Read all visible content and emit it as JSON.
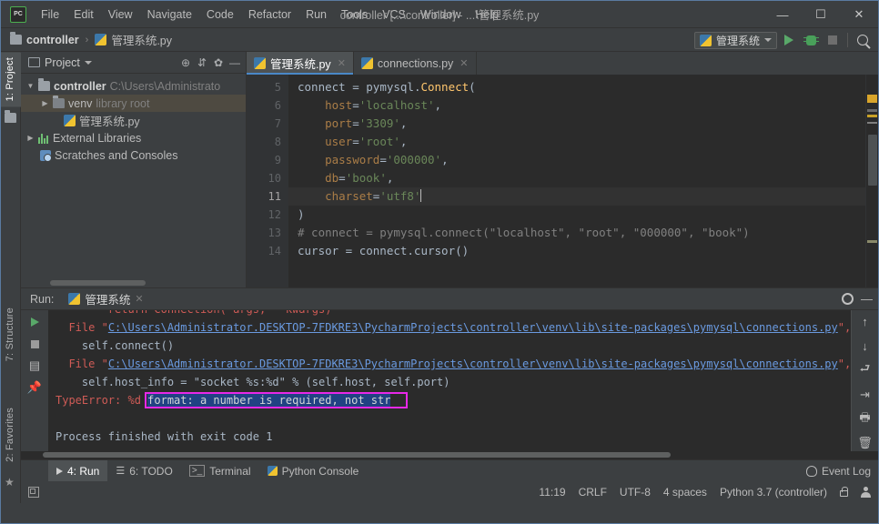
{
  "window": {
    "title": "controller [...\\controller] - ...\\管理系统.py",
    "logo_text": "PC",
    "minimize": "—",
    "maximize": "☐",
    "close": "✕"
  },
  "menu": {
    "items": [
      "File",
      "Edit",
      "View",
      "Navigate",
      "Code",
      "Refactor",
      "Run",
      "Tools",
      "VCS",
      "Window",
      "Help"
    ]
  },
  "breadcrumb": {
    "project": "controller",
    "separator": "›",
    "file": "管理系统.py"
  },
  "toolbar": {
    "run_config": "管理系统",
    "run_label": "Run",
    "debug_label": "Debug",
    "stop_label": "Stop",
    "search_label": "Search Everywhere"
  },
  "left_tool_window_bar": {
    "tabs": [
      "1: Project",
      "7: Structure",
      "2: Favorites"
    ]
  },
  "project_pane": {
    "header_label": "Project",
    "tree": [
      {
        "label": "controller",
        "detail": "C:\\Users\\Administrato",
        "indent": 0,
        "expanded": true,
        "icon": "folder-icon",
        "selected": false,
        "bold": true
      },
      {
        "label": "venv",
        "detail": "library root",
        "indent": 1,
        "expanded": false,
        "icon": "folder-icon",
        "selected": true,
        "bold": false
      },
      {
        "label": "管理系统.py",
        "detail": "",
        "indent": 2,
        "expanded": null,
        "icon": "python-file-icon",
        "selected": false,
        "bold": false
      },
      {
        "label": "External Libraries",
        "detail": "",
        "indent": 0,
        "expanded": false,
        "icon": "library-icon",
        "selected": false,
        "bold": false
      },
      {
        "label": "Scratches and Consoles",
        "detail": "",
        "indent": 0,
        "expanded": null,
        "icon": "scratches-icon",
        "selected": false,
        "bold": false
      }
    ]
  },
  "editor": {
    "tabs": [
      {
        "label": "管理系统.py",
        "active": true,
        "close": "✕"
      },
      {
        "label": "connections.py",
        "active": false,
        "close": "✕"
      }
    ],
    "first_line_number": 5,
    "caret_line": 11,
    "lines": [
      {
        "n": 5,
        "tokens": [
          {
            "t": "connect = ",
            "c": "plain"
          },
          {
            "t": "pymysql",
            "c": "plain"
          },
          {
            "t": ".",
            "c": "plain"
          },
          {
            "t": "Connect",
            "c": "fn"
          },
          {
            "t": "(",
            "c": "plain"
          }
        ]
      },
      {
        "n": 6,
        "tokens": [
          {
            "t": "    ",
            "c": "plain"
          },
          {
            "t": "host",
            "c": "kwarg"
          },
          {
            "t": "=",
            "c": "plain"
          },
          {
            "t": "'localhost'",
            "c": "str"
          },
          {
            "t": ",",
            "c": "plain"
          }
        ]
      },
      {
        "n": 7,
        "tokens": [
          {
            "t": "    ",
            "c": "plain"
          },
          {
            "t": "port",
            "c": "kwarg"
          },
          {
            "t": "=",
            "c": "plain"
          },
          {
            "t": "'3309'",
            "c": "str"
          },
          {
            "t": ",",
            "c": "plain"
          }
        ]
      },
      {
        "n": 8,
        "tokens": [
          {
            "t": "    ",
            "c": "plain"
          },
          {
            "t": "user",
            "c": "kwarg"
          },
          {
            "t": "=",
            "c": "plain"
          },
          {
            "t": "'root'",
            "c": "str"
          },
          {
            "t": ",",
            "c": "plain"
          }
        ]
      },
      {
        "n": 9,
        "tokens": [
          {
            "t": "    ",
            "c": "plain"
          },
          {
            "t": "password",
            "c": "kwarg"
          },
          {
            "t": "=",
            "c": "plain"
          },
          {
            "t": "'000000'",
            "c": "str"
          },
          {
            "t": ",",
            "c": "plain"
          }
        ]
      },
      {
        "n": 10,
        "tokens": [
          {
            "t": "    ",
            "c": "plain"
          },
          {
            "t": "db",
            "c": "kwarg"
          },
          {
            "t": "=",
            "c": "plain"
          },
          {
            "t": "'book'",
            "c": "str"
          },
          {
            "t": ",",
            "c": "plain"
          }
        ]
      },
      {
        "n": 11,
        "tokens": [
          {
            "t": "    ",
            "c": "plain"
          },
          {
            "t": "charset",
            "c": "kwarg"
          },
          {
            "t": "=",
            "c": "plain"
          },
          {
            "t": "'utf8'",
            "c": "str"
          }
        ]
      },
      {
        "n": 12,
        "tokens": [
          {
            "t": ")",
            "c": "plain"
          }
        ]
      },
      {
        "n": 13,
        "tokens": [
          {
            "t": "# connect = pymysql.connect(\"localhost\", \"root\", \"000000\", \"book\")",
            "c": "cmt"
          }
        ]
      },
      {
        "n": 14,
        "tokens": [
          {
            "t": "cursor = connect.cursor()",
            "c": "plain"
          }
        ]
      }
    ]
  },
  "run_panel": {
    "label": "Run:",
    "tab_name": "管理系统",
    "tab_close": "✕",
    "settings_label": "Settings",
    "minimize_label": "Hide",
    "console": [
      {
        "segments": [
          {
            "t": "        return Connection(*args, **kwargs)",
            "c": "err"
          }
        ],
        "clipped_top": true
      },
      {
        "segments": [
          {
            "t": "  ",
            "c": "plain"
          },
          {
            "t": "File \"",
            "c": "err"
          },
          {
            "t": "C:\\Users\\Administrator.DESKTOP-7FDKRE3\\PycharmProjects\\controller\\venv\\lib\\site-packages\\pymysql\\connections.py",
            "c": "lnk"
          },
          {
            "t": "\", l",
            "c": "err"
          }
        ]
      },
      {
        "segments": [
          {
            "t": "    self.connect()",
            "c": "plain"
          }
        ]
      },
      {
        "segments": [
          {
            "t": "  ",
            "c": "plain"
          },
          {
            "t": "File \"",
            "c": "err"
          },
          {
            "t": "C:\\Users\\Administrator.DESKTOP-7FDKRE3\\PycharmProjects\\controller\\venv\\lib\\site-packages\\pymysql\\connections.py",
            "c": "lnk"
          },
          {
            "t": "\", l",
            "c": "err"
          }
        ]
      },
      {
        "segments": [
          {
            "t": "    self.host_info = \"socket %s:%d\" % (self.host, self.port)",
            "c": "plain"
          }
        ]
      },
      {
        "segments": [
          {
            "t": "TypeError: %d ",
            "c": "err"
          },
          {
            "t": "format: a number is required, not str",
            "c": "sel"
          }
        ]
      },
      {
        "segments": [
          {
            "t": "",
            "c": "plain"
          }
        ]
      },
      {
        "segments": [
          {
            "t": "Process finished with exit code 1",
            "c": "plain"
          }
        ]
      }
    ]
  },
  "bottom_tool_bar": {
    "buttons": [
      {
        "label": "4: Run",
        "icon": "play-icon",
        "selected": true
      },
      {
        "label": "6: TODO",
        "icon": "list-icon",
        "selected": false
      },
      {
        "label": "Terminal",
        "icon": "terminal-icon",
        "selected": false
      },
      {
        "label": "Python Console",
        "icon": "python-icon",
        "selected": false
      }
    ],
    "event_log": "Event Log"
  },
  "status_bar": {
    "caret_position": "11:19",
    "line_separator": "CRLF",
    "encoding": "UTF-8",
    "indent": "4 spaces",
    "interpreter": "Python 3.7 (controller)",
    "lock_label": "Read-only toggle",
    "hector_label": "Power save mode"
  },
  "colors": {
    "accent_blue": "#4a88c7",
    "magenta_box": "#e828e8",
    "selection_blue": "#214283",
    "error_red": "#cf5b56",
    "link_blue": "#6a9ae0",
    "editor_bg": "#2b2b2b",
    "panel_bg": "#3c3f41",
    "green_run": "#59a869"
  }
}
